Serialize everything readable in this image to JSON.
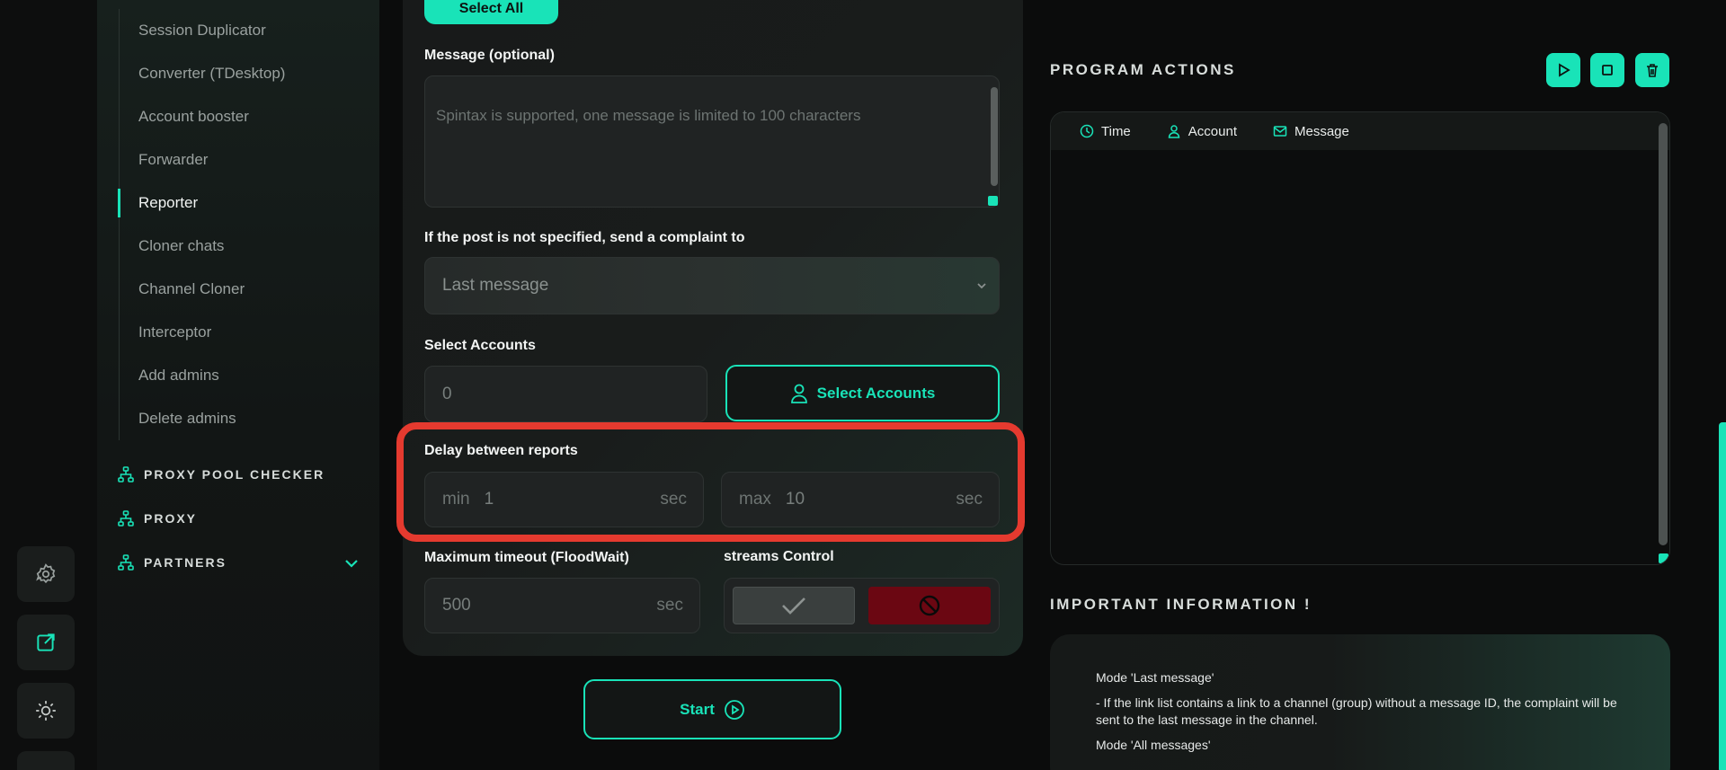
{
  "accent_color": "#19e3b8",
  "rail": {
    "items": [
      {
        "icon": "settings-gear-icon"
      },
      {
        "icon": "external-link-icon"
      },
      {
        "icon": "sun-theme-icon"
      },
      {
        "icon": "grid-menu-icon"
      }
    ]
  },
  "sidebar": {
    "items": [
      {
        "label": "Session Duplicator"
      },
      {
        "label": "Converter (TDesktop)"
      },
      {
        "label": "Account booster"
      },
      {
        "label": "Forwarder"
      },
      {
        "label": "Reporter",
        "active": true
      },
      {
        "label": "Cloner chats"
      },
      {
        "label": "Channel Cloner"
      },
      {
        "label": "Interceptor"
      },
      {
        "label": "Add admins"
      },
      {
        "label": "Delete admins"
      }
    ],
    "groups": [
      {
        "label": "PROXY POOL CHECKER"
      },
      {
        "label": "PROXY"
      },
      {
        "label": "PARTNERS"
      }
    ]
  },
  "form": {
    "select_all_label": "Select All",
    "message_label": "Message (optional)",
    "message_placeholder": "Spintax is supported, one message is limited to 100 characters",
    "complaint_label": "If the post is not specified, send a complaint to",
    "complaint_value": "Last message",
    "select_accounts_label": "Select Accounts",
    "accounts_count": "0",
    "select_accounts_button": "Select Accounts",
    "delay_label": "Delay between reports",
    "delay_min_prefix": "min",
    "delay_min_value": "1",
    "delay_max_prefix": "max",
    "delay_max_value": "10",
    "unit_sec": "sec",
    "timeout_label": "Maximum timeout (FloodWait)",
    "timeout_value": "500",
    "streams_label": "streams Control",
    "start_button": "Start"
  },
  "actions": {
    "title": "PROGRAM ACTIONS",
    "buttons": [
      {
        "icon": "play-icon"
      },
      {
        "icon": "stop-icon"
      },
      {
        "icon": "trash-icon"
      }
    ],
    "columns": [
      {
        "label": "Time",
        "icon": "clock-icon"
      },
      {
        "label": "Account",
        "icon": "user-icon"
      },
      {
        "label": "Message",
        "icon": "mail-icon"
      }
    ]
  },
  "info": {
    "title": "IMPORTANT INFORMATION !",
    "lines": [
      "Mode 'Last message'",
      "- If the link list contains a link to a channel (group) without a message ID, the complaint will be sent to the last message in the channel.",
      "Mode 'All messages'"
    ]
  }
}
